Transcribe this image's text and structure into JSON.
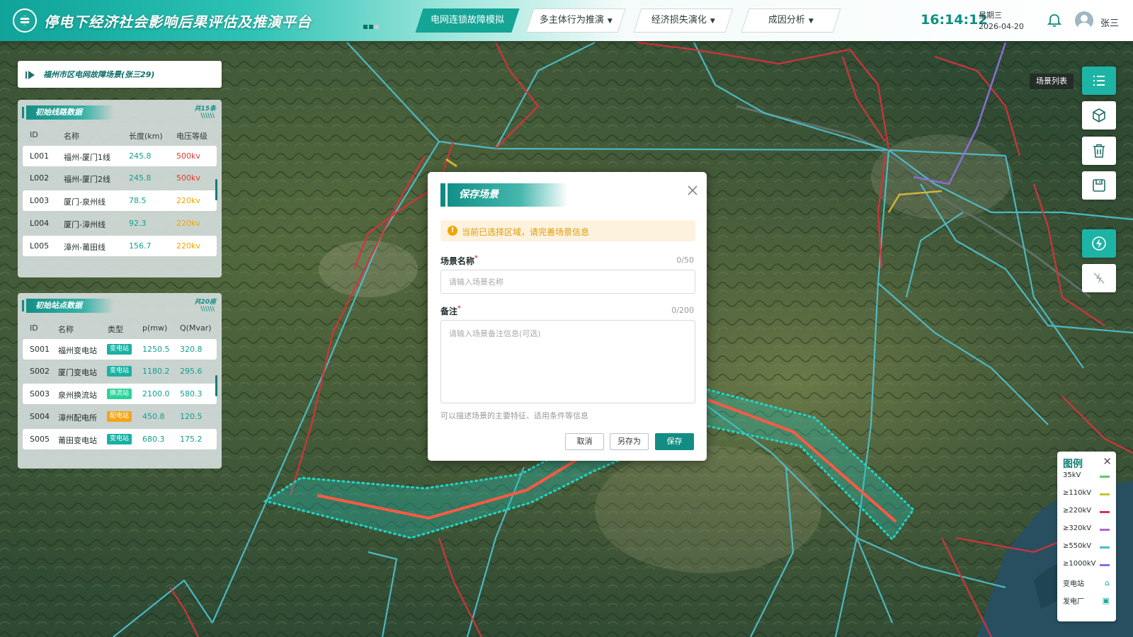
{
  "header": {
    "title": "停电下经济社会影响后果评估及推演平台",
    "nav": [
      {
        "label": "电网连锁故障模拟",
        "active": true,
        "dropdown": false
      },
      {
        "label": "多主体行为推演",
        "active": false,
        "dropdown": true
      },
      {
        "label": "经济损失演化",
        "active": false,
        "dropdown": true
      },
      {
        "label": "成因分析",
        "active": false,
        "dropdown": true
      }
    ],
    "time": "16:14:12",
    "weekday": "星期三",
    "date": "2026-04-20",
    "username": "张三"
  },
  "scene_chip": {
    "label": "福州市区电网故障场景(张三29)"
  },
  "lines_panel": {
    "title": "初始线路数据",
    "count": "共15条",
    "columns": [
      "ID",
      "名称",
      "长度(km)",
      "电压等级"
    ],
    "rows": [
      {
        "id": "L001",
        "name": "福州-厦门1线",
        "length": "245.8",
        "voltage": "500kv"
      },
      {
        "id": "L002",
        "name": "福州-厦门2线",
        "length": "245.8",
        "voltage": "500kv"
      },
      {
        "id": "L003",
        "name": "厦门-泉州线",
        "length": "78.5",
        "voltage": "220kv"
      },
      {
        "id": "L004",
        "name": "厦门-漳州线",
        "length": "92.3",
        "voltage": "220kv"
      },
      {
        "id": "L005",
        "name": "漳州-莆田线",
        "length": "156.7",
        "voltage": "220kv"
      }
    ]
  },
  "stations_panel": {
    "title": "初始站点数据",
    "count": "共20座",
    "columns": [
      "ID",
      "名称",
      "类型",
      "p(mw)",
      "Q(Mvar)"
    ],
    "rows": [
      {
        "id": "S001",
        "name": "福州变电站",
        "type": "变电站",
        "p": "1250.5",
        "q": "320.8"
      },
      {
        "id": "S002",
        "name": "厦门变电站",
        "type": "变电站",
        "p": "1180.2",
        "q": "295.6"
      },
      {
        "id": "S003",
        "name": "泉州换流站",
        "type": "换流站",
        "p": "2100.0",
        "q": "580.3"
      },
      {
        "id": "S004",
        "name": "漳州配电所",
        "type": "配电站",
        "p": "450.8",
        "q": "120.5"
      },
      {
        "id": "S005",
        "name": "莆田变电站",
        "type": "变电站",
        "p": "680.3",
        "q": "175.2"
      }
    ]
  },
  "toolbar": {
    "scene_list_tip": "场景列表",
    "buttons": [
      "list-icon",
      "cube-icon",
      "trash-icon",
      "save-icon",
      "lightning-icon",
      "cut-power-icon"
    ]
  },
  "legend": {
    "title": "图例",
    "items": [
      {
        "label": "35kV",
        "color": "#5cc86a"
      },
      {
        "label": "≥110kV",
        "color": "#c6c43a"
      },
      {
        "label": "≥220kV",
        "color": "#d6364a"
      },
      {
        "label": "≥320kV",
        "color": "#b066d6"
      },
      {
        "label": "≥550kV",
        "color": "#4cbcd0"
      },
      {
        "label": "≥1000kV",
        "color": "#8a6ed8"
      }
    ],
    "icons": [
      {
        "label": "变电站",
        "icon": "substation-icon"
      },
      {
        "label": "发电厂",
        "icon": "power-plant-icon"
      }
    ]
  },
  "modal": {
    "title": "保存场景",
    "notice": "当前已选择区域，请完善场景信息",
    "name_label": "场景名称",
    "name_count": "0/50",
    "name_placeholder": "请输入场景名称",
    "note_label": "备注",
    "note_count": "0/200",
    "note_placeholder": "请输入场景备注信息(可选)",
    "hint": "可以描述场景的主要特征、适用条件等信息",
    "cancel": "取消",
    "save_as": "另存为",
    "save": "保存"
  },
  "colors": {
    "accent": "#14a596",
    "line_500": "#e03a2f",
    "line_220": "#f0a500",
    "map_red": "#d8323c",
    "map_cyan": "#4fc3d3",
    "selection": "#1fd6c8",
    "fault_line": "#ff5a45"
  }
}
